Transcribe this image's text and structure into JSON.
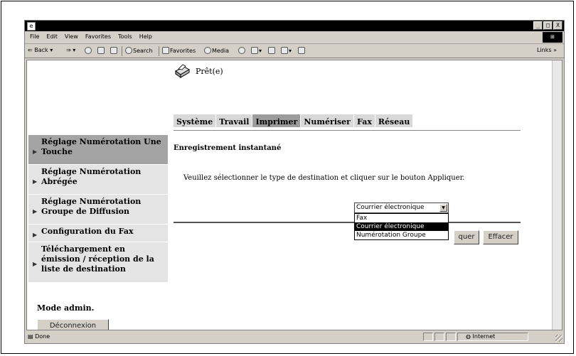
{
  "browser": {
    "menu": [
      "File",
      "Edit",
      "View",
      "Favorites",
      "Tools",
      "Help"
    ],
    "toolbar": {
      "back": "Back",
      "search": "Search",
      "favorites": "Favorites",
      "media": "Media",
      "links": "Links »"
    },
    "status": {
      "done": "Done",
      "zone": "Internet"
    },
    "window_buttons": [
      "_",
      "□",
      "X"
    ]
  },
  "page": {
    "status_text": "Prêt(e)",
    "tabs": [
      {
        "label": "Système",
        "active": false
      },
      {
        "label": "Travail",
        "active": false
      },
      {
        "label": "Imprimer",
        "active": true
      },
      {
        "label": "Numériser",
        "active": false
      },
      {
        "label": "Fax",
        "active": false
      },
      {
        "label": "Réseau",
        "active": false
      }
    ],
    "sidebar": {
      "items": [
        {
          "label": "Réglage Numérotation Une Touche",
          "active": true
        },
        {
          "label": "Réglage Numérotation Abrégée",
          "active": false
        },
        {
          "label": "Réglage Numérotation Groupe de Diffusion",
          "active": false
        },
        {
          "label": "Configuration du Fax",
          "active": false
        },
        {
          "label": "Téléchargement en émission / réception de la liste de destination",
          "active": false
        }
      ],
      "mode_admin": "Mode admin.",
      "logout_label": "Déconnexion"
    },
    "section_title": "Enregistrement instantané",
    "instruction": "Veuillez sélectionner le type de destination et cliquer sur le bouton Appliquer.",
    "select": {
      "selected": "Courrier électronique",
      "options": [
        "Fax",
        "Courrier électronique",
        "Numérotation Groupe"
      ]
    },
    "apply_label": "quer",
    "clear_label": "Effacer"
  }
}
